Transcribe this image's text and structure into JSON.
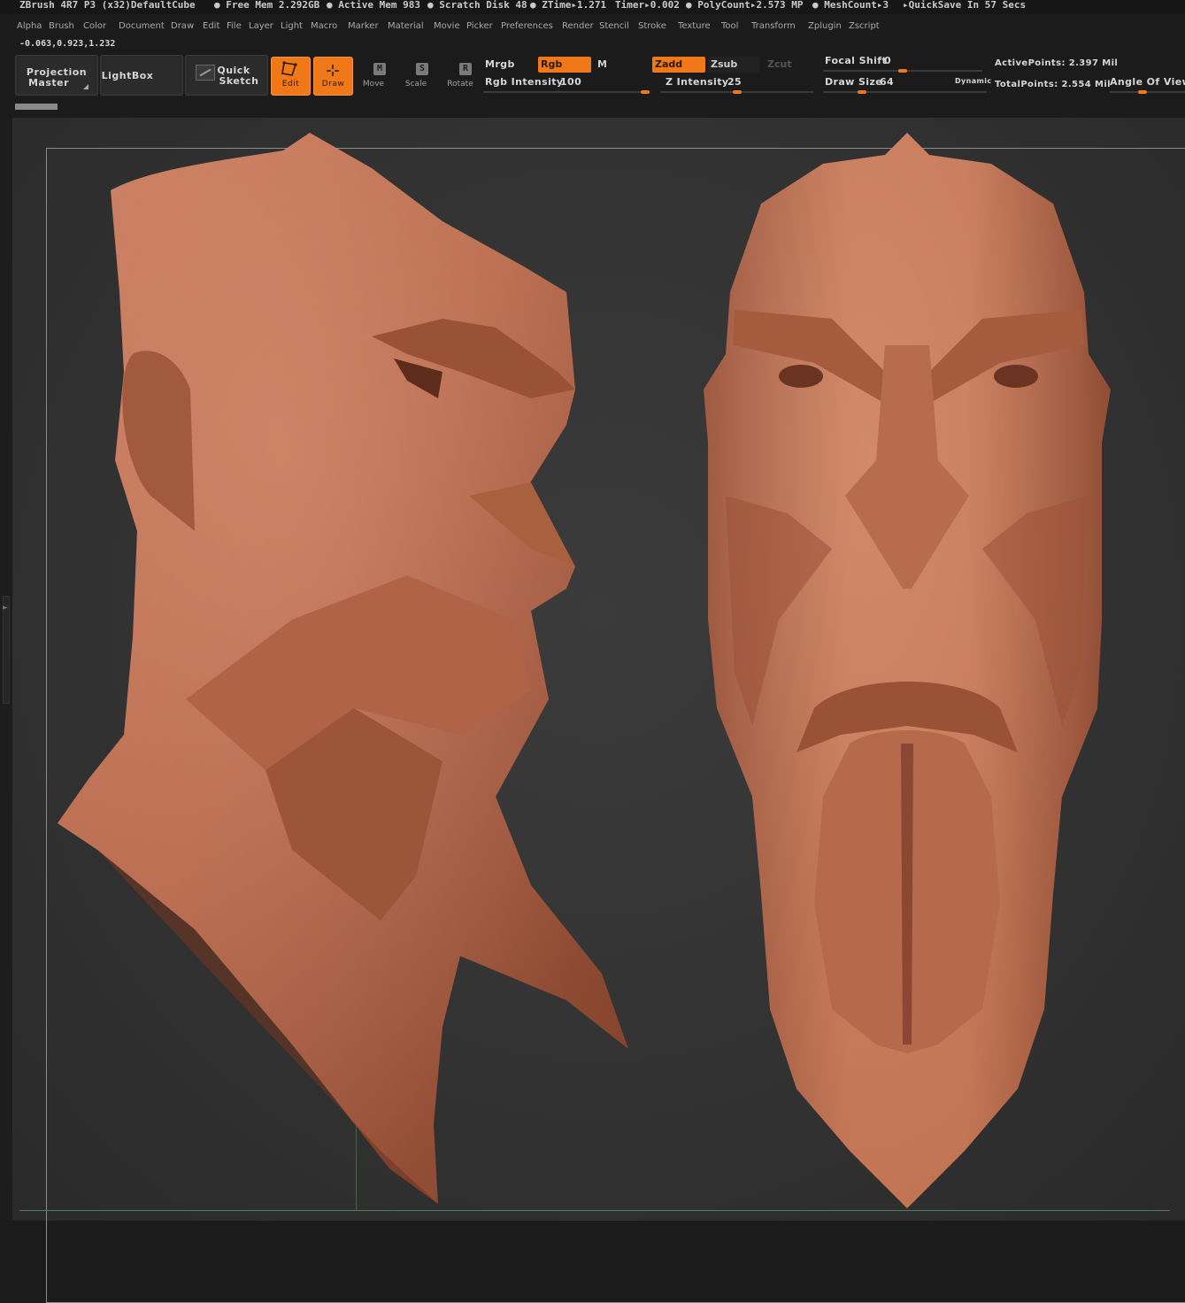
{
  "title_bar": {
    "app": "ZBrush 4R7 P3 (x32)DefaultCube",
    "free_mem": "● Free Mem 2.292GB",
    "active_mem": "● Active Mem 983",
    "scratch": "● Scratch Disk 48",
    "ztime": "● ZTime▸1.271",
    "timer": "Timer▸0.002",
    "polycount": "● PolyCount▸2.573 MP",
    "meshcount": "● MeshCount▸3",
    "quicksave": "▸QuickSave In 57 Secs"
  },
  "menu": [
    "Alpha",
    "Brush",
    "Color",
    "Document",
    "Draw",
    "Edit",
    "File",
    "Layer",
    "Light",
    "Macro",
    "Marker",
    "Material",
    "Movie",
    "Picker",
    "Preferences",
    "Render",
    "Stencil",
    "Stroke",
    "Texture",
    "Tool",
    "Transform",
    "Zplugin",
    "Zscript"
  ],
  "coords": "-0.063,0.923,1.232",
  "shelf": {
    "projection_master_1": "Projection",
    "projection_master_2": "Master",
    "lightbox": "LightBox",
    "quick_sketch_1": "Quick",
    "quick_sketch_2": "Sketch",
    "edit": "Edit",
    "draw": "Draw",
    "move": "Move",
    "move_glyph": "M",
    "scale": "Scale",
    "scale_glyph": "S",
    "rotate": "Rotate",
    "rotate_glyph": "R",
    "mrgb": "Mrgb",
    "rgb": "Rgb",
    "m": "M",
    "zadd": "Zadd",
    "zsub": "Zsub",
    "zcut": "Zcut",
    "rgb_intensity_label": "Rgb Intensity",
    "rgb_intensity": "100",
    "z_intensity_label": "Z Intensity",
    "z_intensity": "25",
    "focal_shift_label": "Focal Shift",
    "focal_shift": "0",
    "draw_size_label": "Draw Size",
    "draw_size": "64",
    "dynamic": "Dynamic",
    "active_points": "ActivePoints: 2.397 Mil",
    "total_points": "TotalPoints: 2.554 Mil",
    "angle_of_view": "Angle Of View"
  },
  "colors": {
    "accent": "#f07819",
    "clay": "#b8664a",
    "background": "#333333"
  },
  "sliders": {
    "rgb_intensity_fraction": 1.0,
    "z_intensity_fraction": 0.25,
    "focal_shift_fraction": 0.5,
    "draw_size_fraction": 0.22
  }
}
